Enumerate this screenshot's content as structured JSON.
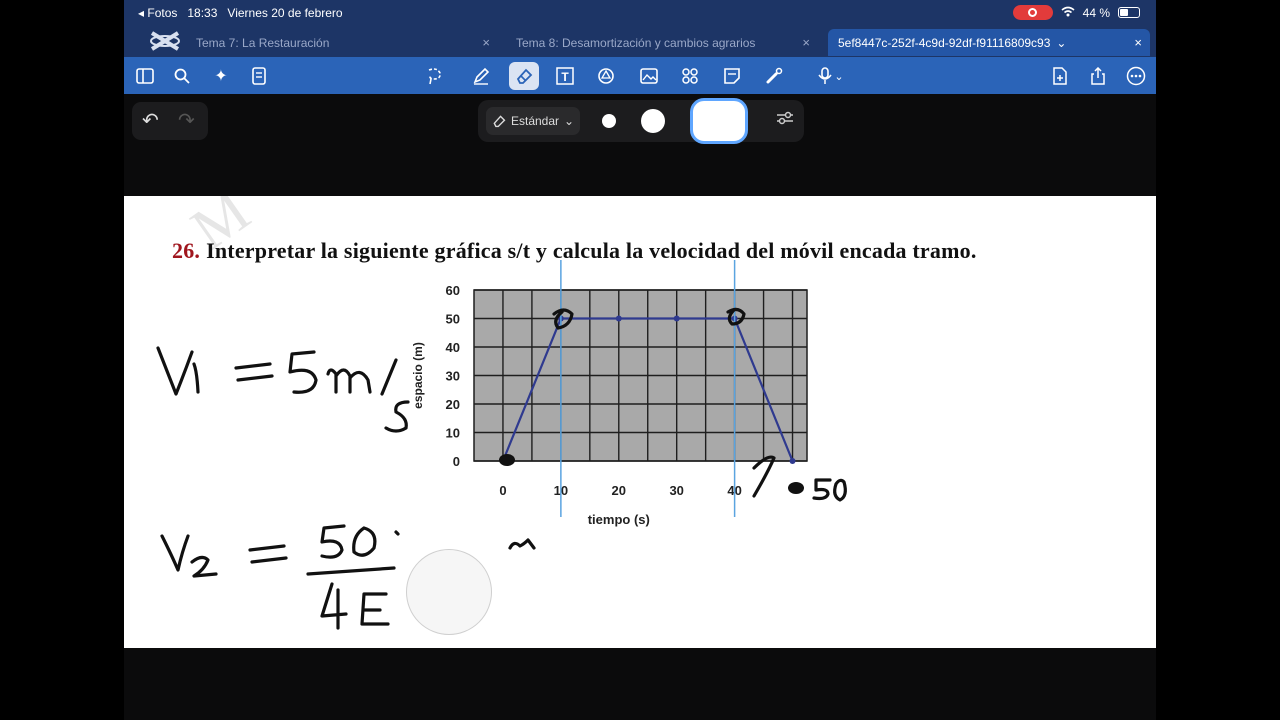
{
  "status": {
    "back_label": "◂ Fotos",
    "time": "18:33",
    "date": "Viernes 20 de febrero",
    "battery": "44 %",
    "battery_level": 0.44,
    "wifi_icon": "wifi-icon",
    "record_icon": "screen-record-icon"
  },
  "tabs": [
    {
      "label": "Tema 7: La Restauración",
      "close": "×"
    },
    {
      "label": "Tema 8: Desamortización y cambios agrarios",
      "close": "×"
    },
    {
      "label": "5ef8447c-252f-4c9d-92df-f91116809c93",
      "chevron": "⌄",
      "close": "×",
      "active": true
    }
  ],
  "toolbar": {
    "left_icons": [
      "sidebar-icon",
      "search-icon",
      "magic-icon",
      "notebook-icon"
    ],
    "center_icons": [
      "lasso-icon",
      "pen-icon",
      "eraser-icon",
      "textbox-icon",
      "shapes-icon",
      "image-icon",
      "elements-icon",
      "sticky-note-icon",
      "laser-pointer-icon",
      "microphone-icon"
    ],
    "right_icons": [
      "add-page-icon",
      "share-icon",
      "more-icon"
    ],
    "selected": "eraser-icon",
    "mic_chevron": "⌄"
  },
  "eraser_options": {
    "mode_label": "Estándar",
    "mode_chevron": "⌄",
    "sizes": [
      "small",
      "medium",
      "large"
    ],
    "selected_size": "large"
  },
  "undo": {
    "undo_glyph": "↶",
    "redo_glyph": "↷"
  },
  "document": {
    "question_number": "26.",
    "question_text": "Interpretar la siguiente gráfica s/t y calcula la velocidad del móvil encada tramo."
  },
  "chart_data": {
    "type": "line",
    "xlabel": "tiempo (s)",
    "ylabel": "espacio (m)",
    "x_ticks": [
      "0",
      "10",
      "20",
      "30",
      "40"
    ],
    "y_ticks": [
      "0",
      "10",
      "20",
      "30",
      "40",
      "50",
      "60"
    ],
    "xlim": [
      -5,
      52.5
    ],
    "ylim": [
      0,
      60
    ],
    "grid": true,
    "series": [
      {
        "x": [
          0,
          10,
          20,
          30,
          40,
          50
        ],
        "y": [
          0,
          50,
          50,
          50,
          50,
          0
        ]
      }
    ],
    "colors": {
      "line": "#2f3a8f",
      "plot_bg": "#a9a9a9",
      "grid": "#1e1e1e"
    }
  },
  "annotations": {
    "v1": "V1 = 5m/s",
    "v2": "V2 = 50/4",
    "tick_50": "50",
    "note_n": "n"
  }
}
